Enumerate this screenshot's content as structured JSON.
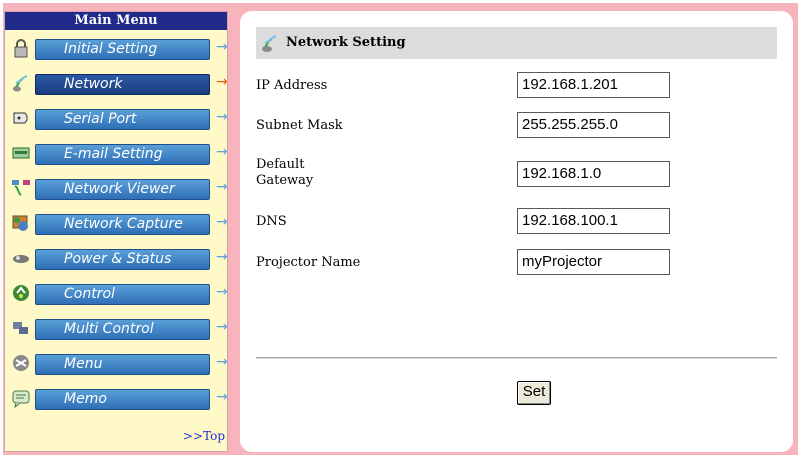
{
  "sidebar": {
    "title": "Main Menu",
    "items": [
      {
        "label": "Initial Setting",
        "icon": "lock-icon"
      },
      {
        "label": "Network",
        "icon": "network-icon",
        "active": true
      },
      {
        "label": "Serial Port",
        "icon": "serial-port-icon"
      },
      {
        "label": "E-mail Setting",
        "icon": "email-icon"
      },
      {
        "label": "Network Viewer",
        "icon": "network-viewer-icon"
      },
      {
        "label": "Network Capture",
        "icon": "network-capture-icon"
      },
      {
        "label": "Power & Status",
        "icon": "projector-icon"
      },
      {
        "label": "Control",
        "icon": "control-icon"
      },
      {
        "label": "Multi Control",
        "icon": "multi-control-icon"
      },
      {
        "label": "Menu",
        "icon": "menu-icon"
      },
      {
        "label": "Memo",
        "icon": "memo-icon"
      }
    ],
    "top_link": ">>Top"
  },
  "main": {
    "title": "Network Setting",
    "fields": [
      {
        "label": "IP Address",
        "value": "192.168.1.201"
      },
      {
        "label": "Subnet Mask",
        "value": "255.255.255.0"
      },
      {
        "label": "Default Gateway",
        "value": "192.168.1.0"
      },
      {
        "label": "DNS",
        "value": "192.168.100.1"
      },
      {
        "label": "Projector Name",
        "value": "myProjector"
      }
    ],
    "set_label": "Set"
  },
  "colors": {
    "background": "#f8b4bc",
    "sidebar_bg": "#fff9c8",
    "menu_header": "#1f2a8a",
    "button": "#3a80c4",
    "active_button": "#1a3c7e",
    "active_arrow": "#e85a10"
  }
}
